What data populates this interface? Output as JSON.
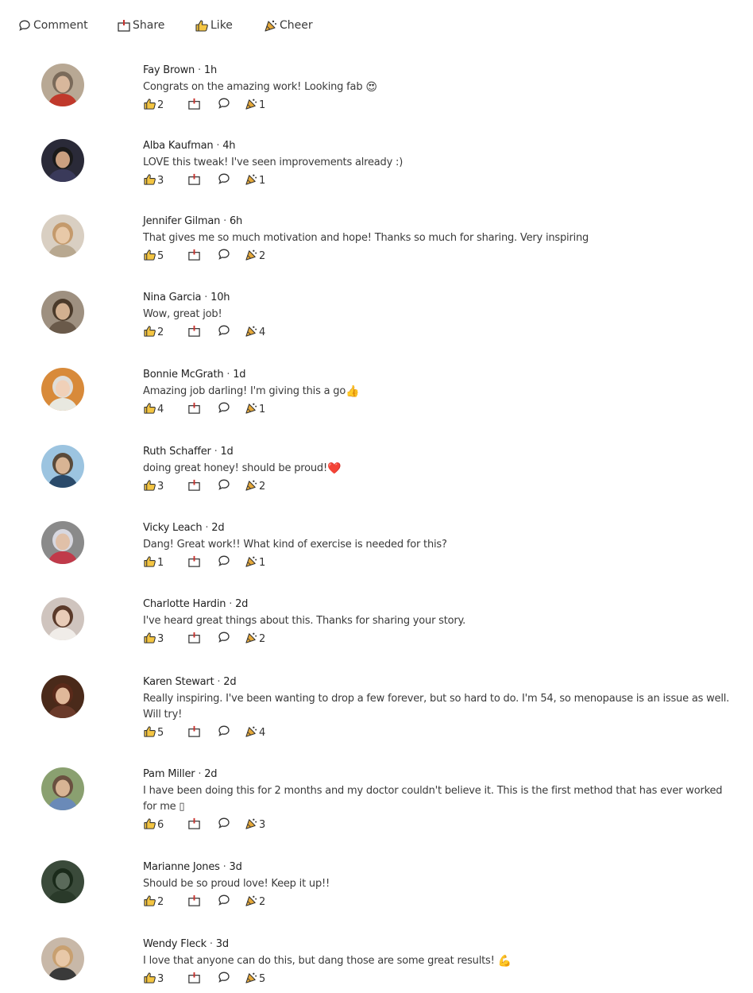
{
  "toolbar": {
    "comment_label": "Comment",
    "share_label": "Share",
    "like_label": "Like",
    "cheer_label": "Cheer"
  },
  "colors": {
    "thumb": "#f4c542",
    "thumb_outline": "#333333",
    "share_box": "#444444",
    "share_accent": "#d9534f",
    "cheer_horn": "#e6a93a",
    "heart": "#e0222b"
  },
  "comments": [
    {
      "name": "Fay Brown",
      "time": "1h",
      "text": "Congrats on the amazing work! Looking fab ",
      "emoji": "😍",
      "likes": "2",
      "cheers": "1",
      "avatar": {
        "bg": "#b8a894",
        "skin": "#d8b79c",
        "shirt": "#c0392b",
        "hair": "#7a6a5a"
      }
    },
    {
      "name": "Alba Kaufman",
      "time": "4h",
      "text": "LOVE this tweak! I've seen improvements already :)",
      "emoji": "",
      "likes": "3",
      "cheers": "1",
      "avatar": {
        "bg": "#2a2a38",
        "skin": "#caa080",
        "shirt": "#3a3a5a",
        "hair": "#1a1a1a"
      }
    },
    {
      "name": "Jennifer Gilman",
      "time": "6h",
      "text": "That gives me so much motivation and hope! Thanks so much for sharing. Very inspiring",
      "emoji": "",
      "likes": "5",
      "cheers": "2",
      "avatar": {
        "bg": "#d9cfc2",
        "skin": "#e8c9a8",
        "shirt": "#b8a890",
        "hair": "#c49a6c"
      }
    },
    {
      "name": "Nina Garcia",
      "time": "10h",
      "text": "Wow, great job!",
      "emoji": "",
      "likes": "2",
      "cheers": "4",
      "avatar": {
        "bg": "#9e9080",
        "skin": "#d2b090",
        "shirt": "#6a5a4a",
        "hair": "#4a3a2a"
      }
    },
    {
      "name": "Bonnie McGrath",
      "time": "1d",
      "text": "Amazing job darling! I'm giving this a go",
      "emoji": "👍",
      "likes": "4",
      "cheers": "1",
      "avatar": {
        "bg": "#d88a3a",
        "skin": "#f0d0b8",
        "shirt": "#e8e8e0",
        "hair": "#e0ddd8"
      }
    },
    {
      "name": "Ruth Schaffer",
      "time": "1d",
      "text": "doing great honey! should be proud!",
      "emoji": "❤️",
      "likes": "3",
      "cheers": "2",
      "avatar": {
        "bg": "#9cc4e0",
        "skin": "#d8b494",
        "shirt": "#2a4a6a",
        "hair": "#5a4a3a"
      }
    },
    {
      "name": "Vicky Leach",
      "time": "2d",
      "text": "Dang! Great work!! What kind of exercise is needed for this?",
      "emoji": "",
      "likes": "1",
      "cheers": "1",
      "avatar": {
        "bg": "#8a8a8a",
        "skin": "#e0c0a8",
        "shirt": "#c03a4a",
        "hair": "#d8d8e0"
      }
    },
    {
      "name": "Charlotte Hardin",
      "time": "2d",
      "text": "I've heard great things about this. Thanks for sharing your story.",
      "emoji": "",
      "likes": "3",
      "cheers": "2",
      "avatar": {
        "bg": "#cfc4be",
        "skin": "#e8ccb8",
        "shirt": "#f0ece8",
        "hair": "#5a3a2a"
      }
    },
    {
      "name": "Karen Stewart",
      "time": "2d",
      "text": "Really inspiring. I've been wanting to drop a few forever, but so hard to do. I'm 54, so menopause is an issue as well. Will try!",
      "emoji": "",
      "likes": "5",
      "cheers": "4",
      "avatar": {
        "bg": "#4a2a1a",
        "skin": "#e0b89a",
        "shirt": "#6a3a2a",
        "hair": "#5a2a1a"
      }
    },
    {
      "name": "Pam Miller",
      "time": "2d",
      "text": "I have been doing this for 2 months and my doctor couldn't believe it. This is the first method that has ever worked for me ▯",
      "emoji": "",
      "likes": "6",
      "cheers": "3",
      "avatar": {
        "bg": "#8aa070",
        "skin": "#d8b494",
        "shirt": "#6a8ab8",
        "hair": "#6a5040"
      }
    },
    {
      "name": "Marianne Jones",
      "time": "3d",
      "text": "Should be so proud love! Keep it up!!",
      "emoji": "",
      "likes": "2",
      "cheers": "2",
      "avatar": {
        "bg": "#3a4a3a",
        "skin": "#5a6a5a",
        "shirt": "#2a3a2a",
        "hair": "#1a2a1a"
      }
    },
    {
      "name": "Wendy Fleck",
      "time": "3d",
      "text": "I love that anyone can do this, but dang those are some great results! ",
      "emoji": "💪",
      "likes": "3",
      "cheers": "5",
      "avatar": {
        "bg": "#c8b8a8",
        "skin": "#e8c8a8",
        "shirt": "#3a3a3a",
        "hair": "#c8a070"
      }
    }
  ]
}
